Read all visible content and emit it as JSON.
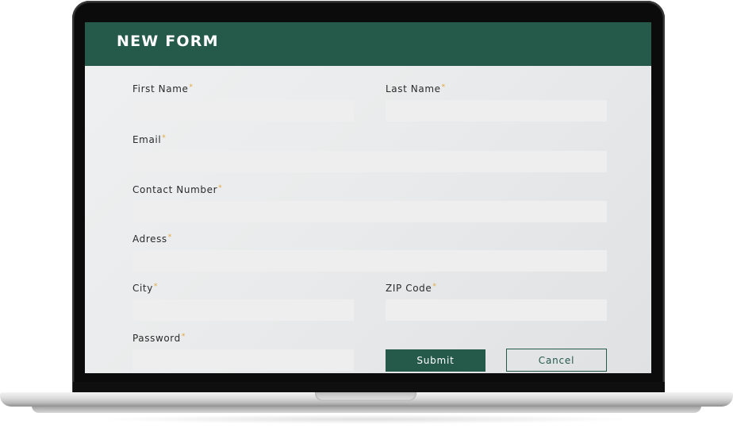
{
  "form": {
    "title": "NEW FORM",
    "required_marker": "*",
    "fields": {
      "first_name": {
        "label": "First Name",
        "value": ""
      },
      "last_name": {
        "label": "Last Name",
        "value": ""
      },
      "email": {
        "label": "Email",
        "value": ""
      },
      "contact_number": {
        "label": "Contact Number",
        "value": ""
      },
      "address": {
        "label": "Adress",
        "value": ""
      },
      "city": {
        "label": "City",
        "value": ""
      },
      "zip_code": {
        "label": "ZIP Code",
        "value": ""
      },
      "password": {
        "label": "Password",
        "value": ""
      }
    },
    "buttons": {
      "submit": "Submit",
      "cancel": "Cancel"
    }
  },
  "colors": {
    "header": "#255a4b",
    "accent": "#255a4b",
    "required": "#e3a53a",
    "field_bg": "#eeeeee",
    "screen_bg": "#eceeef"
  }
}
